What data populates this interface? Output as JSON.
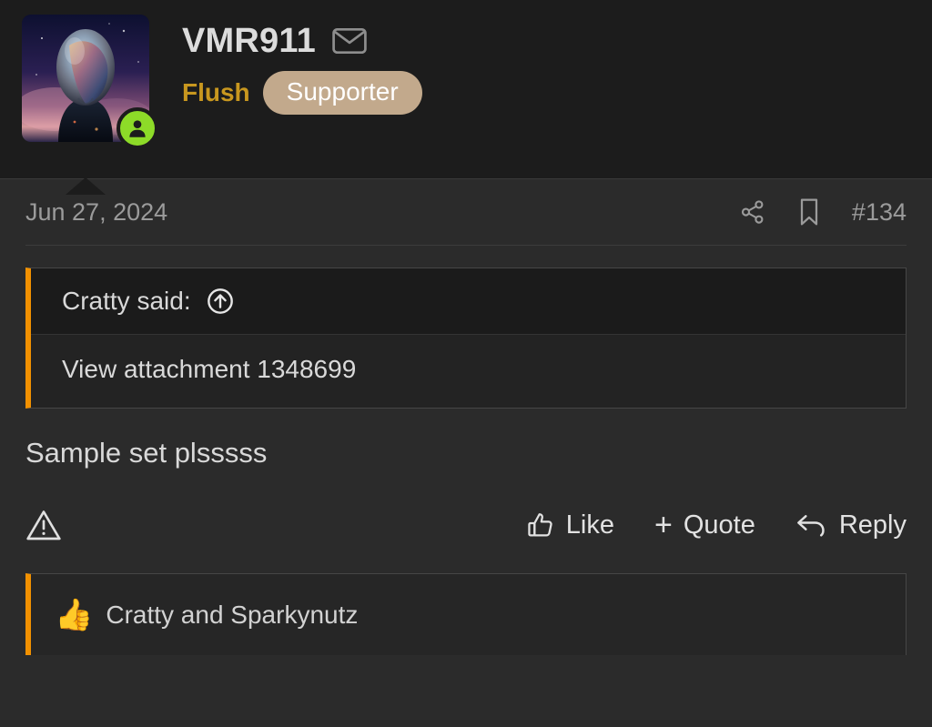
{
  "post": {
    "author": {
      "username": "VMR911",
      "user_title": "Flush",
      "badge": "Supporter",
      "online_status": "online",
      "message_icon": "envelope-icon",
      "avatar_alt": "sci-fi chrome head portrait on nebula background"
    },
    "meta": {
      "date": "Jun 27, 2024",
      "post_number": "#134",
      "share_icon": "share-icon",
      "bookmark_icon": "bookmark-icon"
    },
    "quote": {
      "author_line": "Cratty said:",
      "jump_icon": "arrow-up-circle-icon",
      "content": "View attachment 1348699"
    },
    "message": "Sample set plsssss",
    "actions": {
      "report_icon": "warning-triangle-icon",
      "like_label": "Like",
      "like_icon": "thumbs-up-icon",
      "quote_label": "Quote",
      "quote_icon": "plus-icon",
      "quote_plus": "+",
      "reply_label": "Reply",
      "reply_icon": "reply-arrow-icon"
    },
    "reactions": {
      "emoji": "👍",
      "users": "Cratty and Sparkynutz"
    }
  },
  "colors": {
    "accent_orange": "#f29100",
    "user_title_gold": "#c8971f",
    "badge_bg": "#c2a98c",
    "online_green": "#8ddb28",
    "header_bg": "#1c1c1c",
    "body_bg": "#2b2b2b"
  }
}
